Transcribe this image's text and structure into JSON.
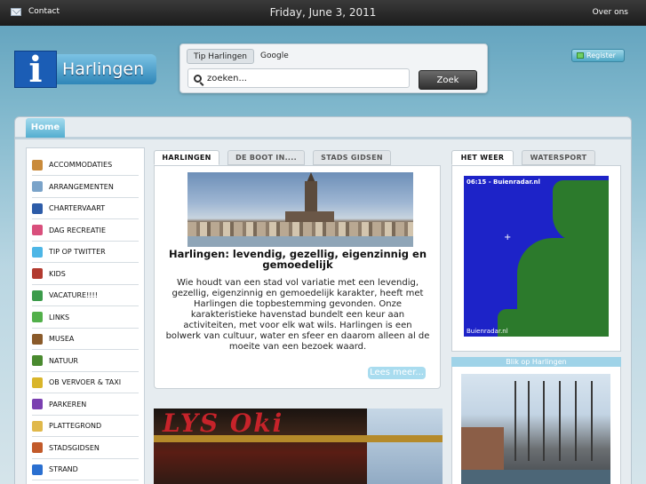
{
  "topbar": {
    "contact": "Contact",
    "date": "Friday, June 3, 2011",
    "about": "Over ons"
  },
  "logo": {
    "letter": "i",
    "name": "Harlingen"
  },
  "search": {
    "tabs": [
      "Tip Harlingen",
      "Google"
    ],
    "placeholder": "zoeken...",
    "button": "Zoek"
  },
  "register": "Register",
  "nav": {
    "home": "Home"
  },
  "sidebar": {
    "items": [
      {
        "label": "ACCOMMODATIES",
        "icon": "house-icon",
        "color": "#c98a3a"
      },
      {
        "label": "ARRANGEMENTEN",
        "icon": "eye-icon",
        "color": "#7aa3c9"
      },
      {
        "label": "CHARTERVAART",
        "icon": "sailboat-icon",
        "color": "#2d5ca8"
      },
      {
        "label": "DAG RECREATIE",
        "icon": "beachball-icon",
        "color": "#d94f7c"
      },
      {
        "label": "TIP OP TWITTER",
        "icon": "twitter-icon",
        "color": "#4db6e6"
      },
      {
        "label": "KIDS",
        "icon": "kids-icon",
        "color": "#b23a2f"
      },
      {
        "label": "VACATURE!!!!",
        "icon": "ball-icon",
        "color": "#3b9b4a"
      },
      {
        "label": "LINKS",
        "icon": "check-icon",
        "color": "#52b04a"
      },
      {
        "label": "MUSEA",
        "icon": "painting-icon",
        "color": "#8a5a2a"
      },
      {
        "label": "NATUUR",
        "icon": "landscape-icon",
        "color": "#4a8a2f"
      },
      {
        "label": "OB VERVOER & TAXI",
        "icon": "bus-icon",
        "color": "#d9b52a"
      },
      {
        "label": "PARKEREN",
        "icon": "parking-icon",
        "color": "#7a3fb0"
      },
      {
        "label": "PLATTEGROND",
        "icon": "map-icon",
        "color": "#e0b84a"
      },
      {
        "label": "STADSGIDSEN",
        "icon": "guide-icon",
        "color": "#c25a2a"
      },
      {
        "label": "STRAND",
        "icon": "beach-icon",
        "color": "#2a6fd0"
      }
    ]
  },
  "center": {
    "tabs": [
      "HARLINGEN",
      "DE BOOT IN....",
      "STADS GIDSEN"
    ],
    "title": "Harlingen: levendig, gezellig, eigenzinnig en gemoedelijk",
    "body": "Wie houdt van een stad vol variatie met een levendig, gezellig, eigenzinnig en gemoedelijk karakter, heeft met Harlingen die topbestemming gevonden. Onze karakteristieke havenstad bundelt een keur aan activiteiten, met voor elk wat wils. Harlingen is een bolwerk van cultuur, water en sfeer en daarom alleen al de moeite van een bezoek waard.",
    "more": "Lees meer..."
  },
  "right": {
    "tabs": [
      "HET WEER",
      "WATERSPORT"
    ],
    "radar_time": "06:15 - Buienradar.nl",
    "radar_brand": "Buienradar.nl",
    "blik_title": "Blik op Harlingen"
  }
}
